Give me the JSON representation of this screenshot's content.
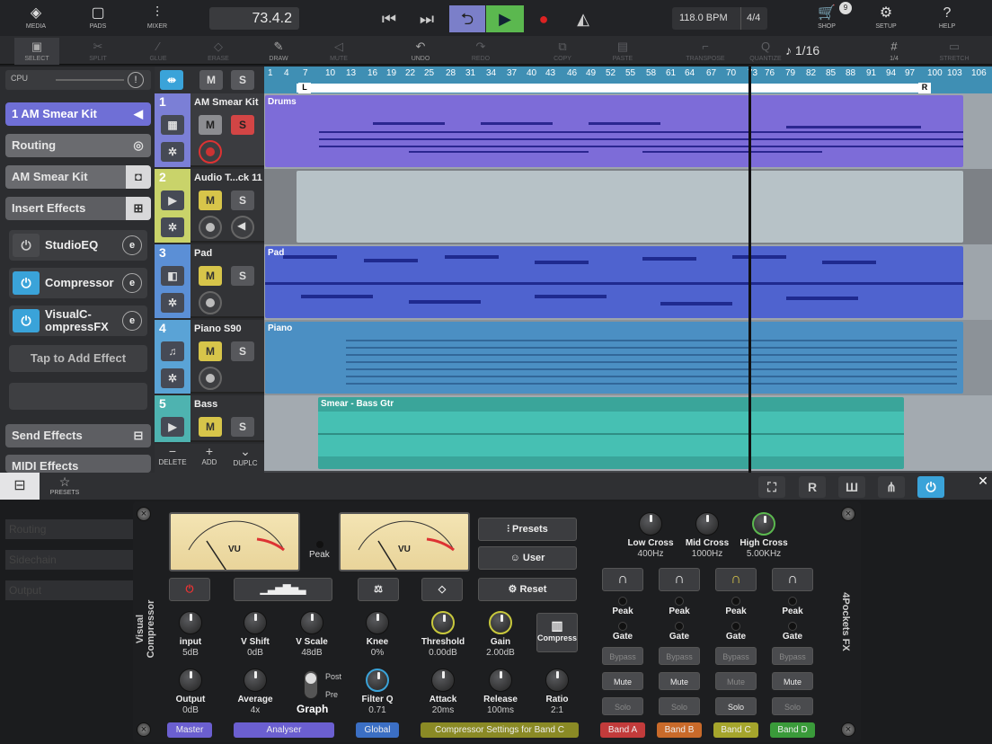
{
  "top": {
    "media": "MEDIA",
    "pads": "PADS",
    "mixer": "MIXER",
    "position": "73.4.2",
    "bpm": "118.0 BPM",
    "signature": "4/4",
    "shop": "SHOP",
    "shop_badge": "9",
    "setup": "SETUP",
    "help": "HELP"
  },
  "tools": {
    "select": "SELECT",
    "split": "SPLIT",
    "glue": "GLUE",
    "erase": "ERASE",
    "draw": "DRAW",
    "mute": "MUTE",
    "undo": "UNDO",
    "redo": "REDO",
    "copy": "COPY",
    "paste": "PASTE",
    "transpose": "TRANSPOSE",
    "quantize": "QUANTIZE",
    "quant_value": "1/16",
    "grid": "1/4",
    "stretch": "STRETCH"
  },
  "sidebar": {
    "cpu": "CPU",
    "track_name": "1  AM Smear Kit",
    "routing": "Routing",
    "instrument": "AM Smear Kit",
    "insert_effects": "Insert Effects",
    "effects": [
      {
        "name": "StudioEQ",
        "on": false
      },
      {
        "name": "Compressor",
        "on": true
      },
      {
        "name": "VisualC-ompressFX",
        "on": true
      }
    ],
    "tap_add": "Tap to Add Effect",
    "send_effects": "Send Effects",
    "midi_effects": "MIDI Effects",
    "ghost": [
      "Routing",
      "Sidechain",
      "Output"
    ]
  },
  "track_header": {
    "m": "M",
    "s": "S",
    "delete": "DELETE",
    "add": "ADD",
    "duplc": "DUPLC"
  },
  "tracks": [
    {
      "num": "1",
      "name": "AM Smear Kit",
      "color": "#7b7fd6"
    },
    {
      "num": "2",
      "name": "Audio T...ck 11",
      "color": "#c9d36a"
    },
    {
      "num": "3",
      "name": "Pad",
      "color": "#5b8fd6"
    },
    {
      "num": "4",
      "name": "Piano S90",
      "color": "#5aa3d6"
    },
    {
      "num": "5",
      "name": "Bass",
      "color": "#4eb3b0"
    }
  ],
  "ruler": [
    "1",
    "4",
    "7",
    "10",
    "13",
    "16",
    "19",
    "22",
    "25",
    "28",
    "31",
    "34",
    "37",
    "40",
    "43",
    "46",
    "49",
    "52",
    "55",
    "58",
    "61",
    "64",
    "67",
    "70",
    "73",
    "76",
    "79",
    "82",
    "85",
    "88",
    "91",
    "94",
    "97",
    "100",
    "103",
    "106"
  ],
  "loop_l": "L",
  "loop_r": "R",
  "clips": [
    {
      "name": "Drums",
      "color": "#7d6cd8"
    },
    {
      "name": "",
      "color": "#b7c2c7"
    },
    {
      "name": "Pad",
      "color": "#4f63cf"
    },
    {
      "name": "Piano",
      "color": "#4b8fc3"
    },
    {
      "name": "Smear - Bass Gtr",
      "color": "#3aa59a"
    }
  ],
  "bottom": {
    "presets": "PRESETS",
    "r": "R"
  },
  "plugin": {
    "title_left": "Visual Compressor",
    "title_right": "4Pockets FX",
    "vu": "VU",
    "peak": "Peak",
    "presets": "Presets",
    "user": "User",
    "reset": "Reset",
    "compress": "Compress",
    "graph": "Graph",
    "post": "Post",
    "pre": "Pre",
    "knobs": [
      {
        "label": "input",
        "value": "5dB"
      },
      {
        "label": "V Shift",
        "value": "0dB"
      },
      {
        "label": "V Scale",
        "value": "48dB"
      },
      {
        "label": "Knee",
        "value": "0%"
      },
      {
        "label": "Threshold",
        "value": "0.00dB"
      },
      {
        "label": "Gain",
        "value": "2.00dB"
      },
      {
        "label": "Output",
        "value": "0dB"
      },
      {
        "label": "Average",
        "value": "4x"
      },
      {
        "label": "Filter Q",
        "value": "0.71"
      },
      {
        "label": "Attack",
        "value": "20ms"
      },
      {
        "label": "Release",
        "value": "100ms"
      },
      {
        "label": "Ratio",
        "value": "2:1"
      }
    ],
    "cross": [
      {
        "label": "Low Cross",
        "value": "400Hz"
      },
      {
        "label": "Mid Cross",
        "value": "1000Hz"
      },
      {
        "label": "High Cross",
        "value": "5.00KHz"
      }
    ],
    "band_peak": "Peak",
    "band_gate": "Gate",
    "bypass": "Bypass",
    "mute": "Mute",
    "solo": "Solo",
    "tabs": [
      "Master",
      "Analyser",
      "Global",
      "Compressor Settings for Band C",
      "Band A",
      "Band B",
      "Band C",
      "Band D"
    ]
  }
}
